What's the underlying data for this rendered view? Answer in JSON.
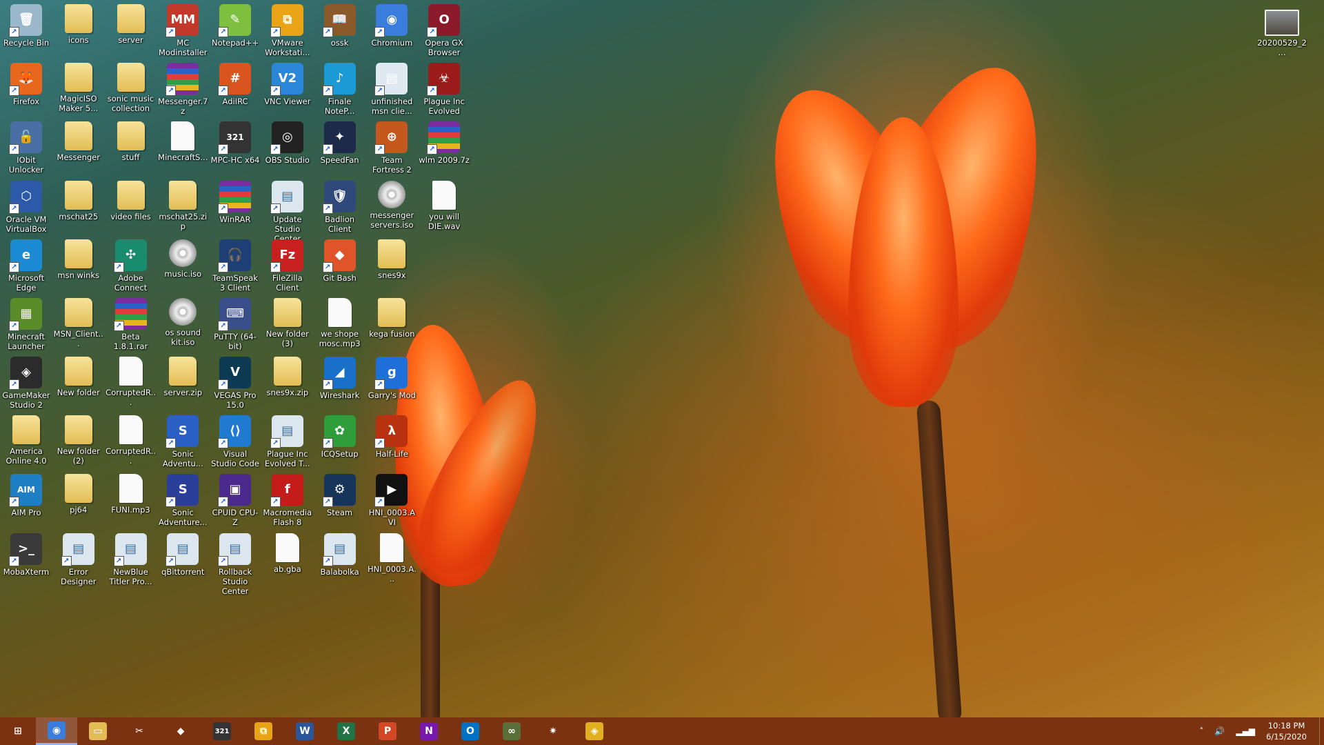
{
  "desktop_icons": [
    {
      "label": "Recycle Bin",
      "icon": "recycle-bin-icon",
      "kind": "app",
      "color": "#9ab7cc",
      "glyph": "🗑"
    },
    {
      "label": "icons",
      "icon": "folder-icon",
      "kind": "folder"
    },
    {
      "label": "server",
      "icon": "folder-icon",
      "kind": "folder"
    },
    {
      "label": "MC Modinstaller",
      "icon": "mc-modinstaller-icon",
      "kind": "app",
      "color": "#c0392b",
      "glyph": "MM"
    },
    {
      "label": "Notepad++",
      "icon": "notepadpp-icon",
      "kind": "app",
      "color": "#7fbf3f",
      "glyph": "✎"
    },
    {
      "label": "VMware Workstati...",
      "icon": "vmware-icon",
      "kind": "app",
      "color": "#e8a317",
      "glyph": "⧉"
    },
    {
      "label": "ossk",
      "icon": "ossk-icon",
      "kind": "app",
      "color": "#8b5a2b",
      "glyph": "📖"
    },
    {
      "label": "Chromium",
      "icon": "chromium-icon",
      "kind": "app",
      "color": "#3b7ddd",
      "glyph": "◉"
    },
    {
      "label": "Opera GX Browser",
      "icon": "opera-gx-icon",
      "kind": "app",
      "color": "#8b1a2b",
      "glyph": "O"
    },
    {
      "label": "Firefox",
      "icon": "firefox-icon",
      "kind": "app",
      "color": "#e8671c",
      "glyph": "🦊"
    },
    {
      "label": "MagicISO Maker 5...",
      "icon": "folder-icon",
      "kind": "folder"
    },
    {
      "label": "sonic music collection",
      "icon": "folder-icon",
      "kind": "folder"
    },
    {
      "label": "Messenger.7z",
      "icon": "archive-icon",
      "kind": "rar"
    },
    {
      "label": "AdiIRC",
      "icon": "adiirc-icon",
      "kind": "app",
      "color": "#d9541e",
      "glyph": "#"
    },
    {
      "label": "VNC Viewer",
      "icon": "vnc-viewer-icon",
      "kind": "app",
      "color": "#2a86d8",
      "glyph": "V2"
    },
    {
      "label": "Finale NoteP...",
      "icon": "finale-notepad-icon",
      "kind": "app",
      "color": "#1b9ad6",
      "glyph": "♪"
    },
    {
      "label": "unfinished msn clie...",
      "icon": "folder-icon",
      "kind": "app",
      "color": "#dfe9f2",
      "glyph": "▤"
    },
    {
      "label": "Plague Inc Evolved",
      "icon": "plague-inc-icon",
      "kind": "app",
      "color": "#9b1b1b",
      "glyph": "☣"
    },
    {
      "label": "IObit Unlocker",
      "icon": "iobit-unlocker-icon",
      "kind": "app",
      "color": "#4a6fa5",
      "glyph": "🔓"
    },
    {
      "label": "Messenger",
      "icon": "folder-icon",
      "kind": "folder"
    },
    {
      "label": "stuff",
      "icon": "folder-icon",
      "kind": "folder"
    },
    {
      "label": "MinecraftS...",
      "icon": "file-icon",
      "kind": "file"
    },
    {
      "label": "MPC-HC x64",
      "icon": "mpc-hc-icon",
      "kind": "app",
      "color": "#333333",
      "glyph": "321"
    },
    {
      "label": "OBS Studio",
      "icon": "obs-studio-icon",
      "kind": "app",
      "color": "#222222",
      "glyph": "◎"
    },
    {
      "label": "SpeedFan",
      "icon": "speedfan-icon",
      "kind": "app",
      "color": "#1e2a4a",
      "glyph": "✦"
    },
    {
      "label": "Team Fortress 2",
      "icon": "tf2-icon",
      "kind": "app",
      "color": "#c5581c",
      "glyph": "⊕"
    },
    {
      "label": "wlm 2009.7z",
      "icon": "archive-icon",
      "kind": "rar"
    },
    {
      "label": "Oracle VM VirtualBox",
      "icon": "virtualbox-icon",
      "kind": "app",
      "color": "#2d5aa8",
      "glyph": "⬡"
    },
    {
      "label": "mschat25",
      "icon": "folder-icon",
      "kind": "folder"
    },
    {
      "label": "video files",
      "icon": "folder-icon",
      "kind": "folder"
    },
    {
      "label": "mschat25.zip",
      "icon": "zip-folder-icon",
      "kind": "folder"
    },
    {
      "label": "WinRAR",
      "icon": "winrar-icon",
      "kind": "rar"
    },
    {
      "label": "Update Studio Center",
      "icon": "update-studio-icon",
      "kind": "app",
      "color": "#dce6ee",
      "glyph": "▤"
    },
    {
      "label": "Badlion Client",
      "icon": "badlion-icon",
      "kind": "app",
      "color": "#2f4a7a",
      "glyph": "🛡"
    },
    {
      "label": "messenger servers.iso",
      "icon": "disc-icon",
      "kind": "disc"
    },
    {
      "label": "you will DIE.wav",
      "icon": "wav-file-icon",
      "kind": "file"
    },
    {
      "label": "Microsoft Edge",
      "icon": "edge-icon",
      "kind": "app",
      "color": "#1b8bd6",
      "glyph": "e"
    },
    {
      "label": "msn winks",
      "icon": "folder-icon",
      "kind": "folder"
    },
    {
      "label": "Adobe Connect",
      "icon": "adobe-connect-icon",
      "kind": "app",
      "color": "#1a8c6e",
      "glyph": "✣"
    },
    {
      "label": "music.iso",
      "icon": "disc-icon",
      "kind": "disc"
    },
    {
      "label": "TeamSpeak 3 Client",
      "icon": "teamspeak-icon",
      "kind": "app",
      "color": "#1d3f75",
      "glyph": "🎧"
    },
    {
      "label": "FileZilla Client",
      "icon": "filezilla-icon",
      "kind": "app",
      "color": "#c8201e",
      "glyph": "Fz"
    },
    {
      "label": "Git Bash",
      "icon": "git-bash-icon",
      "kind": "app",
      "color": "#e0542a",
      "glyph": "◆"
    },
    {
      "label": "snes9x",
      "icon": "folder-icon",
      "kind": "folder"
    },
    {
      "label": "Minecraft Launcher",
      "icon": "minecraft-icon",
      "kind": "app",
      "color": "#5b8c2a",
      "glyph": "▦"
    },
    {
      "label": "MSN_Client...",
      "icon": "folder-icon",
      "kind": "folder"
    },
    {
      "label": "Beta 1.8.1.rar",
      "icon": "archive-icon",
      "kind": "rar"
    },
    {
      "label": "os sound kit.iso",
      "icon": "disc-icon",
      "kind": "disc"
    },
    {
      "label": "PuTTY (64-bit)",
      "icon": "putty-icon",
      "kind": "app",
      "color": "#3a4e8c",
      "glyph": "⌨"
    },
    {
      "label": "New folder (3)",
      "icon": "folder-icon",
      "kind": "folder"
    },
    {
      "label": "we shope mosc.mp3",
      "icon": "mp3-file-icon",
      "kind": "file"
    },
    {
      "label": "kega fusion",
      "icon": "folder-icon",
      "kind": "folder"
    },
    {
      "label": "GameMaker Studio 2",
      "icon": "gamemaker-icon",
      "kind": "app",
      "color": "#2b2b2b",
      "glyph": "◈"
    },
    {
      "label": "New folder",
      "icon": "folder-icon",
      "kind": "folder"
    },
    {
      "label": "CorruptedR...",
      "icon": "file-icon",
      "kind": "file"
    },
    {
      "label": "server.zip",
      "icon": "zip-folder-icon",
      "kind": "folder"
    },
    {
      "label": "VEGAS Pro 15.0",
      "icon": "vegas-pro-icon",
      "kind": "app",
      "color": "#0b3a52",
      "glyph": "V"
    },
    {
      "label": "snes9x.zip",
      "icon": "zip-folder-icon",
      "kind": "folder"
    },
    {
      "label": "Wireshark",
      "icon": "wireshark-icon",
      "kind": "app",
      "color": "#1a6fc9",
      "glyph": "◢"
    },
    {
      "label": "Garry's Mod",
      "icon": "garrys-mod-icon",
      "kind": "app",
      "color": "#1e6fd9",
      "glyph": "g"
    },
    {
      "label": "America Online 4.0",
      "icon": "folder-icon",
      "kind": "folder"
    },
    {
      "label": "New folder (2)",
      "icon": "folder-icon",
      "kind": "folder"
    },
    {
      "label": "CorruptedR...",
      "icon": "file-icon",
      "kind": "file"
    },
    {
      "label": "Sonic Adventu...",
      "icon": "sonic-adventure-icon",
      "kind": "app",
      "color": "#2a5fc4",
      "glyph": "S"
    },
    {
      "label": "Visual Studio Code",
      "icon": "vscode-icon",
      "kind": "app",
      "color": "#1f7ad0",
      "glyph": "⟨⟩"
    },
    {
      "label": "Plague Inc Evolved T...",
      "icon": "plague-inc-trainer-icon",
      "kind": "app",
      "color": "#dce6ee",
      "glyph": "▤"
    },
    {
      "label": "ICQSetup",
      "icon": "icqsetup-icon",
      "kind": "app",
      "color": "#2f9e3a",
      "glyph": "✿"
    },
    {
      "label": "Half-Life",
      "icon": "half-life-icon",
      "kind": "app",
      "color": "#b8320f",
      "glyph": "λ"
    },
    {
      "label": "AIM Pro",
      "icon": "aim-pro-icon",
      "kind": "app",
      "color": "#1f7fc4",
      "glyph": "AIM"
    },
    {
      "label": "pj64",
      "icon": "folder-icon",
      "kind": "folder"
    },
    {
      "label": "FUNI.mp3",
      "icon": "mp3-file-icon",
      "kind": "file"
    },
    {
      "label": "Sonic Adventure...",
      "icon": "sonic-adventure-2-icon",
      "kind": "app",
      "color": "#2a3f9a",
      "glyph": "S"
    },
    {
      "label": "CPUID CPU-Z",
      "icon": "cpu-z-icon",
      "kind": "app",
      "color": "#4a2a8c",
      "glyph": "▣"
    },
    {
      "label": "Macromedia Flash 8",
      "icon": "flash-icon",
      "kind": "app",
      "color": "#c41b1b",
      "glyph": "f"
    },
    {
      "label": "Steam",
      "icon": "steam-icon",
      "kind": "app",
      "color": "#17345a",
      "glyph": "⚙"
    },
    {
      "label": "HNI_0003.AVI",
      "icon": "video-file-icon",
      "kind": "app",
      "color": "#111111",
      "glyph": "▶"
    },
    {
      "label": "MobaXterm",
      "icon": "mobaxterm-icon",
      "kind": "app",
      "color": "#3a3a3a",
      "glyph": ">_"
    },
    {
      "label": "Error Designer",
      "icon": "error-designer-icon",
      "kind": "app",
      "color": "#dce6ee",
      "glyph": "▤"
    },
    {
      "label": "NewBlue Titler Pro...",
      "icon": "newblue-titler-icon",
      "kind": "app",
      "color": "#dce6ee",
      "glyph": "▤"
    },
    {
      "label": "qBittorrent",
      "icon": "qbittorrent-icon",
      "kind": "app",
      "color": "#dce6ee",
      "glyph": "▤"
    },
    {
      "label": "Rollback Studio Center",
      "icon": "rollback-studio-icon",
      "kind": "app",
      "color": "#dce6ee",
      "glyph": "▤"
    },
    {
      "label": "ab.gba",
      "icon": "file-icon",
      "kind": "file"
    },
    {
      "label": "Balabolka",
      "icon": "balabolka-icon",
      "kind": "app",
      "color": "#dce6ee",
      "glyph": "▤"
    },
    {
      "label": "HNI_0003.A...",
      "icon": "file-icon",
      "kind": "file"
    }
  ],
  "desktop_top_right": {
    "label": "20200529_2...",
    "icon": "image-thumbnail-icon"
  },
  "taskbar": {
    "apps": [
      {
        "name": "start-button",
        "icon": "windows-icon",
        "glyph": "⊞",
        "color": "#7a3210",
        "active": false
      },
      {
        "name": "chromium",
        "icon": "chromium-icon",
        "glyph": "◉",
        "color": "#3b7ddd",
        "active": true
      },
      {
        "name": "file-explorer",
        "icon": "folder-icon",
        "glyph": "▭",
        "color": "#e3bd54",
        "active": false
      },
      {
        "name": "snipping-tool",
        "icon": "scissors-icon",
        "glyph": "✂",
        "color": "#7a3210",
        "active": false
      },
      {
        "name": "gem-app",
        "icon": "gem-icon",
        "glyph": "◆",
        "color": "#7a3210",
        "active": false
      },
      {
        "name": "mpc-hc",
        "icon": "mpc-hc-icon",
        "glyph": "321",
        "color": "#333333",
        "active": false
      },
      {
        "name": "vmware",
        "icon": "vmware-icon",
        "glyph": "⧉",
        "color": "#e8a317",
        "active": false
      },
      {
        "name": "word",
        "icon": "word-icon",
        "glyph": "W",
        "color": "#2b579a",
        "active": false
      },
      {
        "name": "excel",
        "icon": "excel-icon",
        "glyph": "X",
        "color": "#217346",
        "active": false
      },
      {
        "name": "powerpoint",
        "icon": "powerpoint-icon",
        "glyph": "P",
        "color": "#d24726",
        "active": false
      },
      {
        "name": "onenote",
        "icon": "onenote-icon",
        "glyph": "N",
        "color": "#7719aa",
        "active": false
      },
      {
        "name": "outlook",
        "icon": "outlook-icon",
        "glyph": "O",
        "color": "#0072c6",
        "active": false
      },
      {
        "name": "infinity-app",
        "icon": "infinity-icon",
        "glyph": "∞",
        "color": "#5a6e3a",
        "active": false
      },
      {
        "name": "pinwheel-app",
        "icon": "pinwheel-icon",
        "glyph": "✷",
        "color": "#7a3210",
        "active": false
      },
      {
        "name": "diamond-app",
        "icon": "diamond-icon",
        "glyph": "◈",
        "color": "#e0b020",
        "active": false
      }
    ],
    "tray": {
      "chevron": "˄",
      "time": "10:18 PM",
      "date": "6/15/2020"
    }
  }
}
